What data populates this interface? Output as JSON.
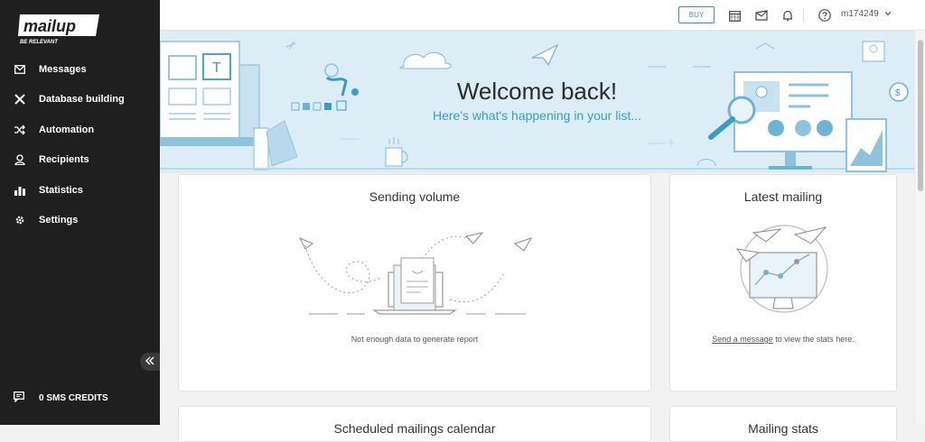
{
  "brand": {
    "logo_text": "mailup",
    "tagline": "BE RELEVANT"
  },
  "sidebar": {
    "items": [
      {
        "label": "Messages",
        "icon": "envelope-icon"
      },
      {
        "label": "Database building",
        "icon": "tools-icon"
      },
      {
        "label": "Automation",
        "icon": "shuffle-icon"
      },
      {
        "label": "Recipients",
        "icon": "user-icon"
      },
      {
        "label": "Statistics",
        "icon": "bar-chart-icon"
      },
      {
        "label": "Settings",
        "icon": "gear-icon"
      }
    ],
    "sms_credits": "0 SMS CREDITS"
  },
  "topbar": {
    "buy_label": "BUY",
    "username": "m174249"
  },
  "banner": {
    "title": "Welcome back!",
    "subtitle": "Here's what's happening in your list..."
  },
  "cards": {
    "sending_volume": {
      "title": "Sending volume",
      "note": "Not enough data to generate report"
    },
    "latest_mailing": {
      "title": "Latest mailing",
      "link": "Send a message",
      "note_suffix": " to view the stats here."
    },
    "scheduled": {
      "title": "Scheduled mailings calendar"
    },
    "mailing_stats": {
      "title": "Mailing stats"
    }
  },
  "colors": {
    "sidebar_bg": "#1f1f1f",
    "banner_bg": "#dcedf6",
    "accent": "#3a9bc7"
  }
}
